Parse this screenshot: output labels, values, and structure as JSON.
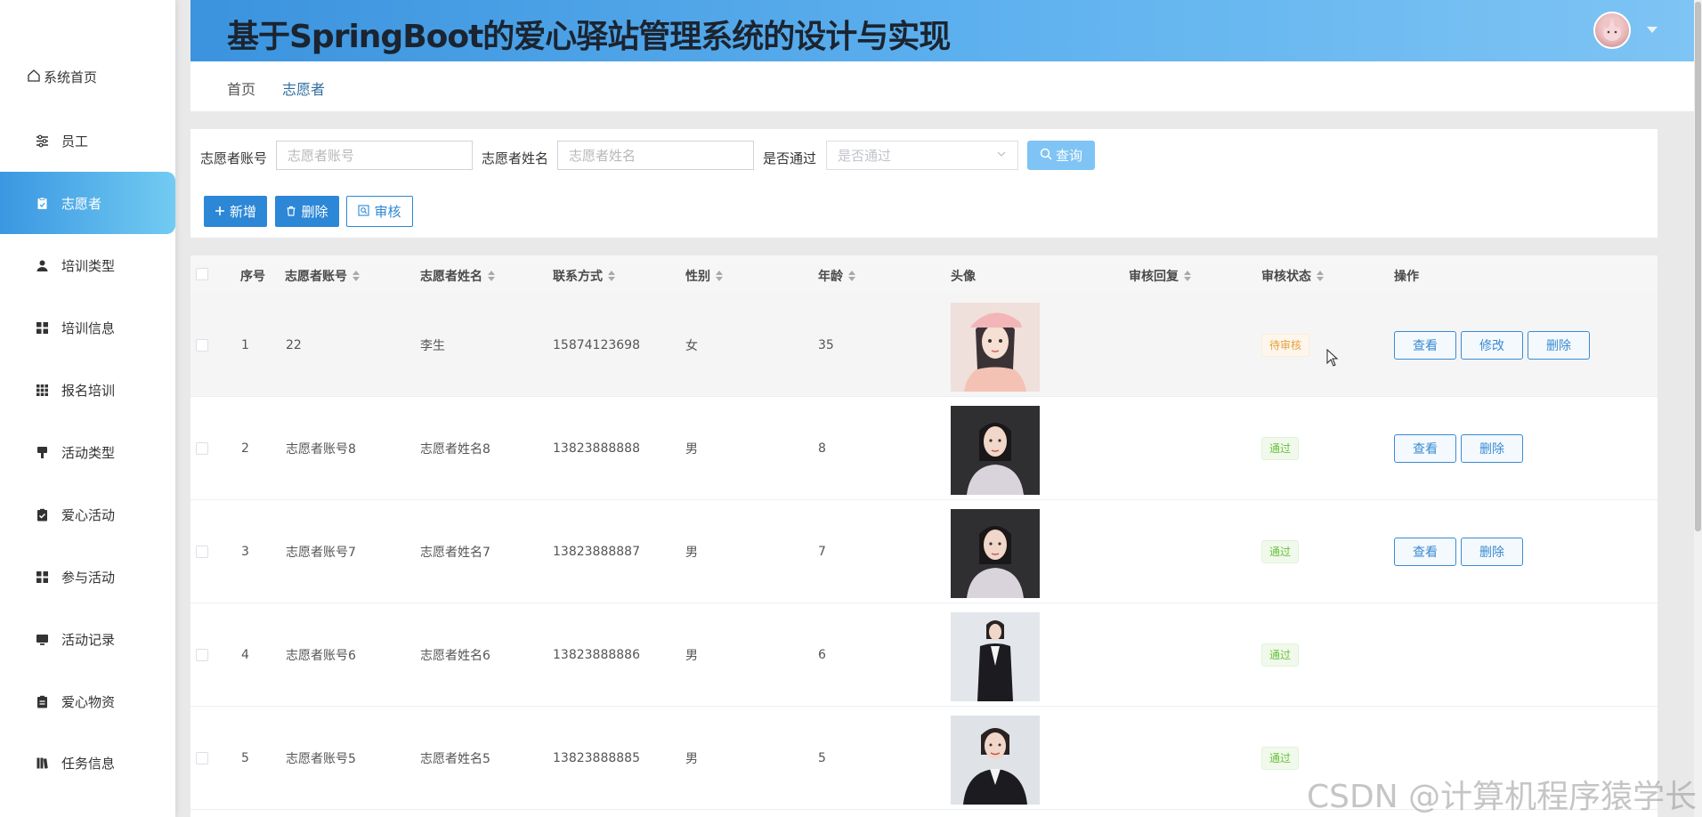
{
  "app": {
    "title": "基于SpringBoot的爱心驿站管理系统的设计与实现"
  },
  "sidebar": {
    "home_label": "系统首页",
    "items": [
      {
        "label": "员工",
        "icon": "sliders-icon",
        "active": false
      },
      {
        "label": "志愿者",
        "icon": "clipboard-icon",
        "active": true
      },
      {
        "label": "培训类型",
        "icon": "user-icon",
        "active": false
      },
      {
        "label": "培训信息",
        "icon": "grid-icon",
        "active": false
      },
      {
        "label": "报名培训",
        "icon": "apps-icon",
        "active": false
      },
      {
        "label": "活动类型",
        "icon": "brush-icon",
        "active": false
      },
      {
        "label": "爱心活动",
        "icon": "clipboard-check-icon",
        "active": false
      },
      {
        "label": "参与活动",
        "icon": "grid-icon",
        "active": false
      },
      {
        "label": "活动记录",
        "icon": "monitor-icon",
        "active": false
      },
      {
        "label": "爱心物资",
        "icon": "clipboard-list-icon",
        "active": false
      },
      {
        "label": "任务信息",
        "icon": "book-icon",
        "active": false
      }
    ]
  },
  "breadcrumb": {
    "home": "首页",
    "current": "志愿者"
  },
  "search": {
    "account_label": "志愿者账号",
    "account_placeholder": "志愿者账号",
    "name_label": "志愿者姓名",
    "name_placeholder": "志愿者姓名",
    "pass_label": "是否通过",
    "pass_placeholder": "是否通过",
    "query_label": "查询"
  },
  "actions": {
    "add_label": "新增",
    "delete_label": "删除",
    "audit_label": "审核"
  },
  "table": {
    "headers": {
      "index": "序号",
      "account": "志愿者账号",
      "name": "志愿者姓名",
      "phone": "联系方式",
      "gender": "性别",
      "age": "年龄",
      "photo": "头像",
      "reply": "审核回复",
      "status": "审核状态",
      "ops": "操作"
    },
    "rows": [
      {
        "index": "1",
        "account": "22",
        "name": "李生",
        "phone": "15874123698",
        "gender": "女",
        "age": "35",
        "status": "待审核",
        "view": "查看",
        "edit": "修改",
        "delete": "删除"
      },
      {
        "index": "2",
        "account": "志愿者账号8",
        "name": "志愿者姓名8",
        "phone": "13823888888",
        "gender": "男",
        "age": "8",
        "status": "通过",
        "view": "查看",
        "delete": "删除"
      },
      {
        "index": "3",
        "account": "志愿者账号7",
        "name": "志愿者姓名7",
        "phone": "13823888887",
        "gender": "男",
        "age": "7",
        "status": "通过",
        "view": "查看",
        "delete": "删除"
      },
      {
        "index": "4",
        "account": "志愿者账号6",
        "name": "志愿者姓名6",
        "phone": "13823888886",
        "gender": "男",
        "age": "6",
        "status": "通过"
      },
      {
        "index": "5",
        "account": "志愿者账号5",
        "name": "志愿者姓名5",
        "phone": "13823888885",
        "gender": "男",
        "age": "5",
        "status": "通过"
      }
    ]
  },
  "watermark": "CSDN @计算机程序猿学长",
  "colors": {
    "accent": "#2c87d6",
    "header_start": "#3b93de",
    "header_end": "#7ec4f4",
    "pending": "#e6a23c",
    "passed": "#67c23a"
  }
}
